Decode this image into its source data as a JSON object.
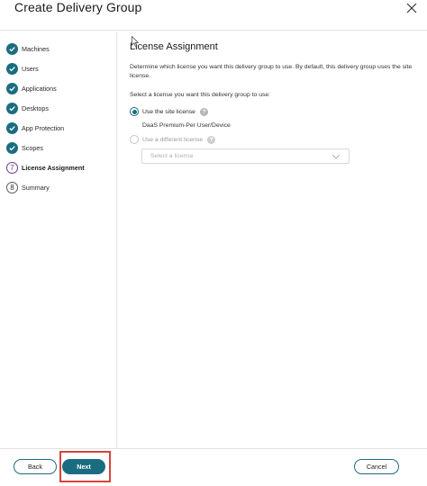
{
  "dialog": {
    "title": "Create Delivery Group"
  },
  "steps": [
    {
      "label": "Machines",
      "status": "done"
    },
    {
      "label": "Users",
      "status": "done"
    },
    {
      "label": "Applications",
      "status": "done"
    },
    {
      "label": "Desktops",
      "status": "done"
    },
    {
      "label": "App Protection",
      "status": "done"
    },
    {
      "label": "Scopes",
      "status": "done"
    },
    {
      "label": "License Assignment",
      "status": "current",
      "number": "7"
    },
    {
      "label": "Summary",
      "status": "todo",
      "number": "8"
    }
  ],
  "main": {
    "title": "License Assignment",
    "description": "Determine which license you want this delivery group to use. By default, this delivery group uses the site license.",
    "prompt": "Select a license you want this delivery group to use:",
    "options": [
      {
        "label": "Use the site license",
        "checked": true,
        "help_icon": "?"
      },
      {
        "label": "Use a different license",
        "checked": false,
        "help_icon": "?"
      }
    ],
    "site_license_name": "DaaS Premium-Per User/Device",
    "select_placeholder": "Select a license"
  },
  "footer": {
    "back_label": "Back",
    "next_label": "Next",
    "cancel_label": "Cancel"
  },
  "colors": {
    "accent": "#1a6d80",
    "current_step": "#6d3a8c",
    "highlight": "#d8433b"
  }
}
